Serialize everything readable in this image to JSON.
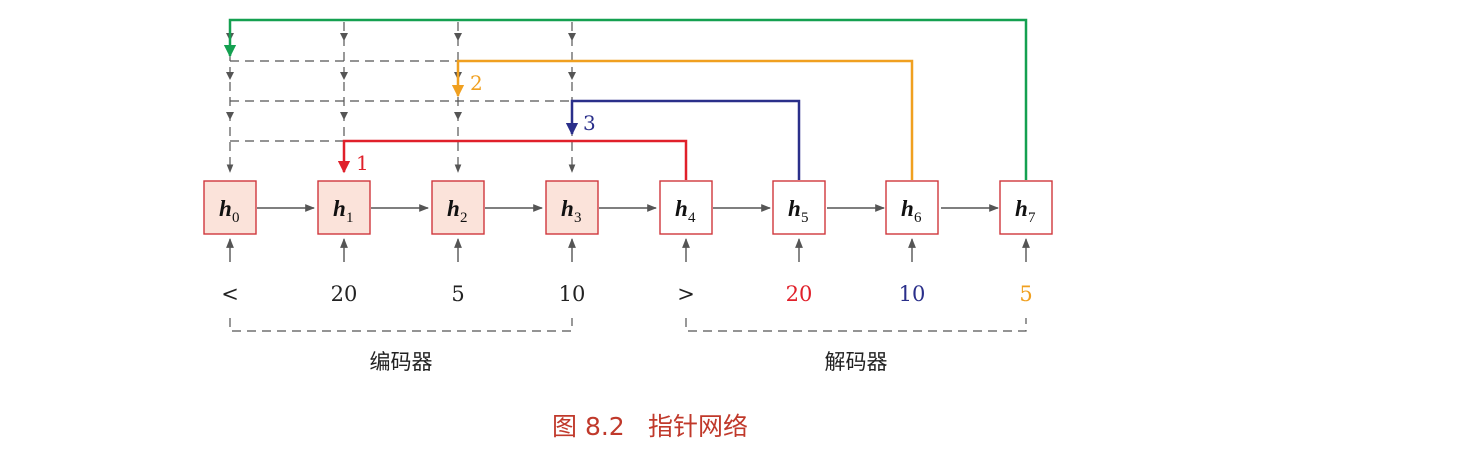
{
  "encoder_states": [
    {
      "var": "h",
      "sub": "0"
    },
    {
      "var": "h",
      "sub": "1"
    },
    {
      "var": "h",
      "sub": "2"
    },
    {
      "var": "h",
      "sub": "3"
    }
  ],
  "decoder_states": [
    {
      "var": "h",
      "sub": "4"
    },
    {
      "var": "h",
      "sub": "5"
    },
    {
      "var": "h",
      "sub": "6"
    },
    {
      "var": "h",
      "sub": "7"
    }
  ],
  "encoder_inputs": [
    "<",
    "20",
    "5",
    "10"
  ],
  "decoder_inputs": [
    "> ",
    "20",
    "10",
    "5"
  ],
  "encoder_label": "编码器",
  "decoder_label": "解码器",
  "pointers": [
    {
      "order": "1",
      "color": "#e0202a"
    },
    {
      "order": "2",
      "color": "#f0a020"
    },
    {
      "order": "3",
      "color": "#2a2f8a"
    },
    {
      "order": "",
      "color": "#14a050"
    }
  ],
  "decoder_input_colors": [
    "#222222",
    "#e0202a",
    "#2a2f8a",
    "#f0a020"
  ],
  "caption": {
    "number": "图 8.2",
    "title": "指针网络"
  },
  "colors": {
    "box_border": "#d0373c",
    "encoder_fill": "#fbe3da",
    "decoder_fill": "#ffffff",
    "caption": "#c0392b",
    "arrow": "#555555",
    "dash": "#555555"
  }
}
